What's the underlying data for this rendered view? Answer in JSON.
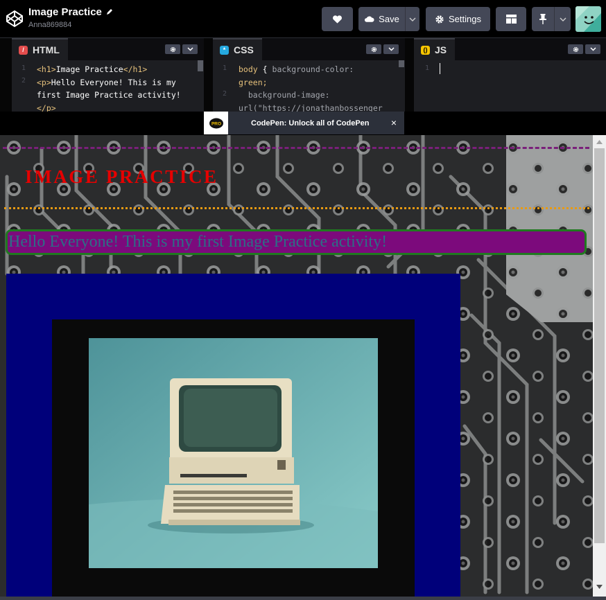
{
  "header": {
    "title": "Image Practice",
    "author": "Anna869884",
    "save_label": "Save",
    "settings_label": "Settings"
  },
  "editors": {
    "html": {
      "label": "HTML",
      "line_numbers": [
        "1",
        "2"
      ],
      "lines": [
        {
          "open": "<h1>",
          "text": "Image Practice",
          "close": "</h1>"
        },
        {
          "open": "<p>",
          "text": "Hello Everyone! This is my"
        },
        {
          "text": "first Image Practice activity!"
        },
        {
          "close": "</p>"
        }
      ]
    },
    "css": {
      "label": "CSS",
      "line_numbers": [
        "1",
        "2"
      ],
      "line1_selector": "body",
      "line1_brace": "{",
      "line1_prop": "background-color:",
      "line1_value": "green;",
      "line2_prop": "background-image:",
      "line2_value": "url(\"https://jonathanbossenger"
    },
    "js": {
      "label": "JS",
      "line_numbers": [
        "1"
      ]
    }
  },
  "promo": {
    "badge": "PRO",
    "text": "CodePen: Unlock all of CodePen",
    "close": "×"
  },
  "preview": {
    "heading": "IMAGE PRACTICE",
    "paragraph": "Hello Everyone! This is my first Image Practice activity!"
  },
  "colors": {
    "heading": "#e60000",
    "paragraph_text": "#2c6e86",
    "paragraph_bg": "#7c0a7c",
    "paragraph_border": "#1f7a1f",
    "image_frame": "#00007a",
    "dashed_rule": "#7a1f7a",
    "dotted_rule": "#e89a12"
  },
  "icons": [
    "codepen-logo-icon",
    "pencil-icon",
    "heart-icon",
    "cloud-icon",
    "chevron-down-icon",
    "gear-icon",
    "layout-icon",
    "pin-icon",
    "close-icon"
  ]
}
